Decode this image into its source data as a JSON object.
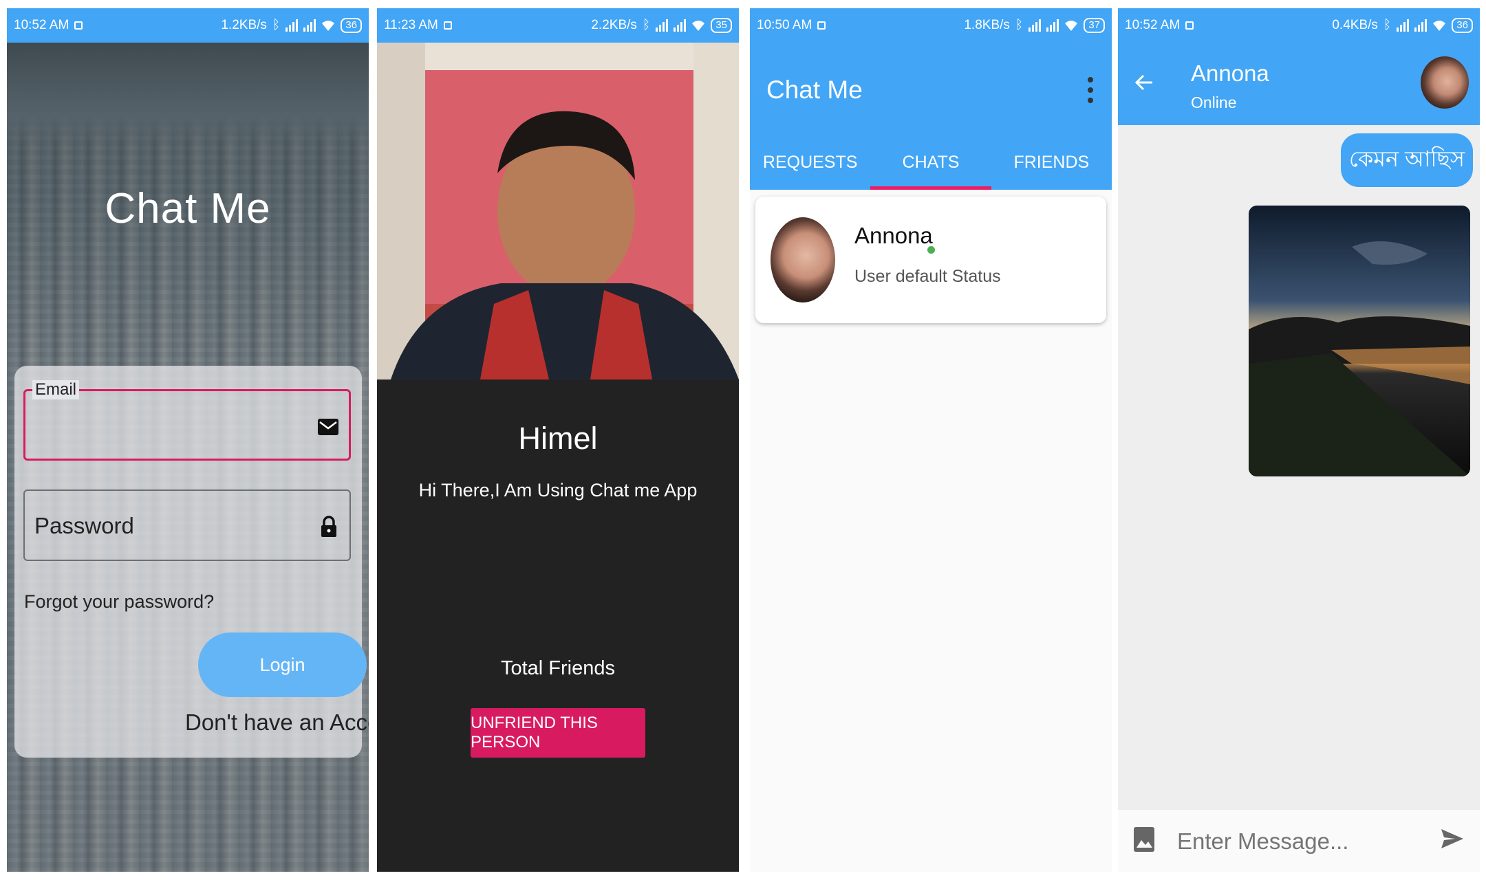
{
  "login": {
    "status": {
      "time": "10:52 AM",
      "speed": "1.2KB/s",
      "battery": "36"
    },
    "title": "Chat Me",
    "email_label": "Email",
    "password_placeholder": "Password",
    "forgot": "Forgot your password?",
    "login_button": "Login",
    "signup_link": "Don't have an Account"
  },
  "profile": {
    "status": {
      "time": "11:23 AM",
      "speed": "2.2KB/s",
      "battery": "35"
    },
    "name": "Himel",
    "status_text": "Hi There,I Am Using Chat me App",
    "total_friends": "Total Friends",
    "unfriend_button": "UNFRIEND THIS PERSON"
  },
  "chats": {
    "status": {
      "time": "10:50 AM",
      "speed": "1.8KB/s",
      "battery": "37"
    },
    "title": "Chat Me",
    "tabs": [
      {
        "label": "REQUESTS"
      },
      {
        "label": "CHATS",
        "active": true
      },
      {
        "label": "FRIENDS"
      }
    ],
    "items": [
      {
        "name": "Annona",
        "status": "User default Status",
        "online": true
      }
    ]
  },
  "conversation": {
    "status": {
      "time": "10:52 AM",
      "speed": "0.4KB/s",
      "battery": "36"
    },
    "contact_name": "Annona",
    "presence": "Online",
    "messages": [
      {
        "type": "text",
        "text": "কেমন আছিস"
      },
      {
        "type": "image"
      }
    ],
    "input_placeholder": "Enter Message..."
  },
  "colors": {
    "primary": "#42a5f5",
    "accent": "#d81b60",
    "tab_indicator": "#e91e63",
    "dark_bg": "#222222"
  },
  "icons": [
    "email-icon",
    "lock-icon",
    "more-vert-icon",
    "back-arrow-icon",
    "image-icon",
    "send-icon",
    "bluetooth-icon",
    "signal-icon",
    "wifi-icon"
  ]
}
